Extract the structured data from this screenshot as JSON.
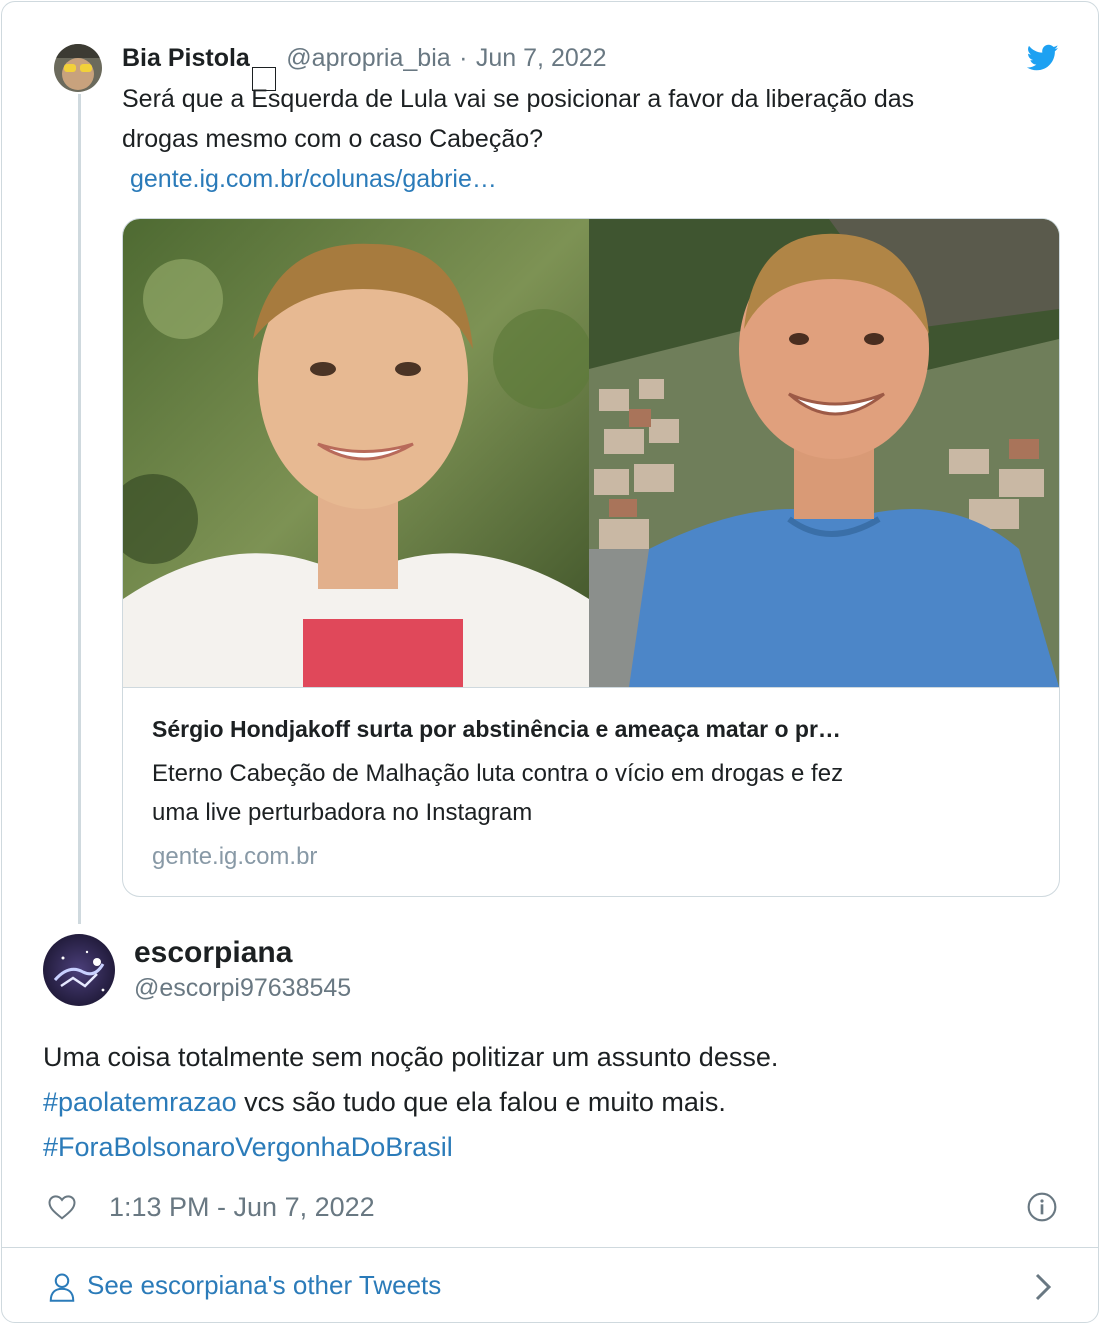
{
  "quoted": {
    "author_name": "Bia Pistola",
    "author_badge": " ",
    "author_handle": "@apropria_bia",
    "separator": "·",
    "date": "Jun 7, 2022",
    "text_line1": "Será que a Esquerda de Lula vai se posicionar a favor da liberação das",
    "text_line2": "drogas mesmo com o caso Cabeção?",
    "link": "gente.ig.com.br/colunas/gabrie…",
    "icon": "twitter-bird-icon"
  },
  "preview": {
    "title": "Sérgio Hondjakoff surta por abstinência e ameaça matar o pr…",
    "desc_line1": "Eterno Cabeção de Malhação luta contra o vício em drogas e fez",
    "desc_line2": "uma live perturbadora no Instagram",
    "domain": "gente.ig.com.br"
  },
  "main": {
    "author_name": "escorpiana",
    "author_handle": "@escorpi97638545",
    "line1": "Uma coisa totalmente sem noção politizar um assunto desse.",
    "hashtag1": "#paolatemrazao",
    "line2_rest": " vcs são tudo que ela falou e muito mais.",
    "hashtag2": "#ForaBolsonaroVergonhaDoBrasil",
    "timestamp": "1:13 PM - Jun 7, 2022"
  },
  "footer": {
    "see_more": "See escorpiana's other Tweets"
  },
  "colors": {
    "link": "#2b7bb9",
    "twitter": "#1da1f2",
    "border": "#cfd9de"
  }
}
